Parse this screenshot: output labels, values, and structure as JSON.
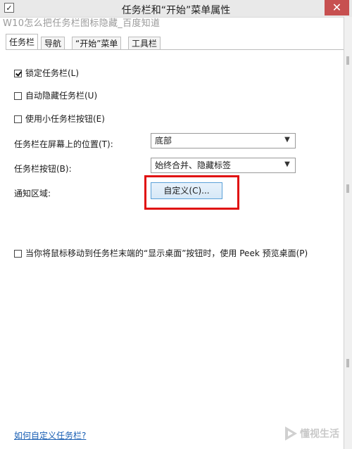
{
  "window": {
    "title": "任务栏和“开始”菜单属性",
    "close_glyph": "✕",
    "icon_glyph": "✓"
  },
  "watermark": {
    "top_text": "W10怎么把任务栏图标隐藏_百度知道",
    "bottom_text": "懂视生活"
  },
  "tabs": [
    {
      "label": "任务栏"
    },
    {
      "label": "导航"
    },
    {
      "label": "“开始”菜单"
    },
    {
      "label": "工具栏"
    }
  ],
  "options": {
    "lock_taskbar": "锁定任务栏(L)",
    "auto_hide": "自动隐藏任务栏(U)",
    "small_buttons": "使用小任务栏按钮(E)",
    "peek": "当你将鼠标移动到任务栏末端的“显示桌面”按钮时，使用 Peek 预览桌面(P)"
  },
  "position": {
    "label": "任务栏在屏幕上的位置(T):",
    "value": "底部"
  },
  "buttons_setting": {
    "label": "任务栏按钮(B):",
    "value": "始终合并、隐藏标签"
  },
  "notify": {
    "label": "通知区域:",
    "button": "自定义(C)..."
  },
  "help_link": "如何自定义任务栏?",
  "colors": {
    "highlight": "#e01010",
    "link": "#1a5fb4",
    "close": "#c75050"
  }
}
